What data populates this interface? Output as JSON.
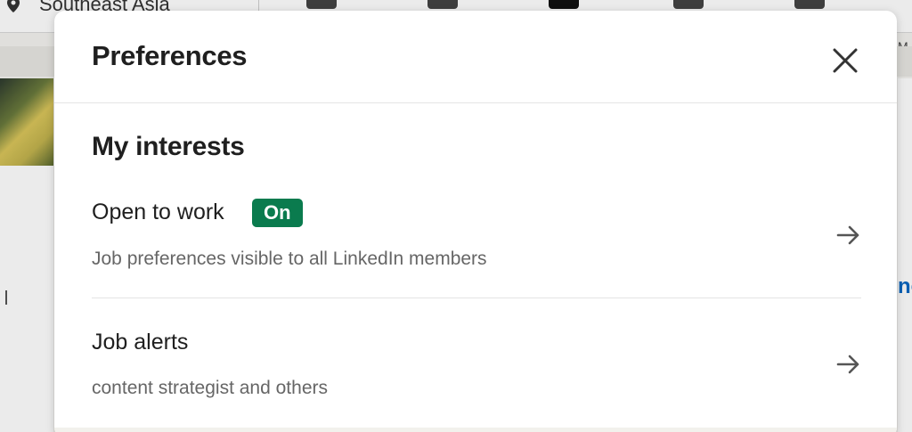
{
  "background": {
    "location_text": "Southeast Asia",
    "right_edge_letter": "M",
    "right_edge_link": "no"
  },
  "modal": {
    "title": "Preferences",
    "close_icon": "close-icon",
    "section_title": "My interests",
    "items": [
      {
        "title": "Open to work",
        "badge": "On",
        "subtitle": "Job preferences visible to all LinkedIn members",
        "icon": "arrow-right-icon"
      },
      {
        "title": "Job alerts",
        "subtitle": "content strategist and others",
        "icon": "arrow-right-icon"
      }
    ]
  },
  "colors": {
    "badge_bg": "#0a7b4e",
    "title_text": "#1f1f1f",
    "subtitle_text": "#666666",
    "link_blue": "#0a66c2"
  }
}
